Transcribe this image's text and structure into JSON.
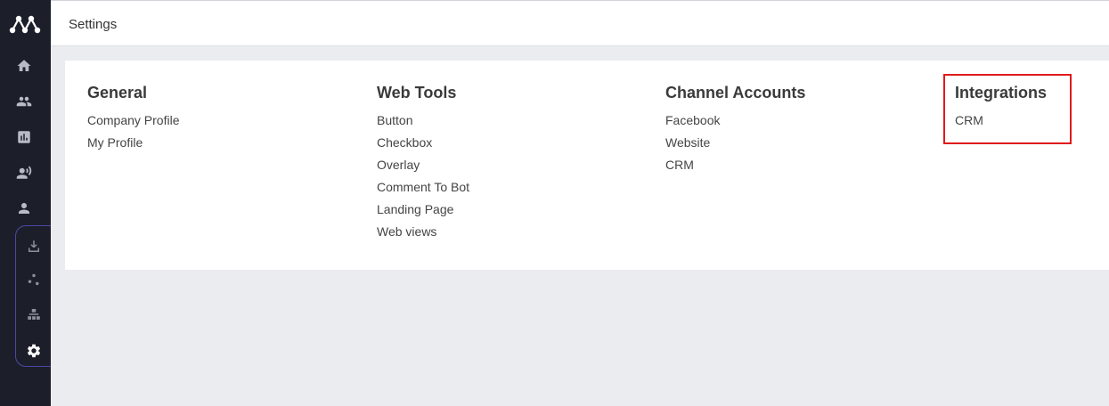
{
  "header": {
    "title": "Settings"
  },
  "sidebar": {
    "items": [
      {
        "icon": "home-icon"
      },
      {
        "icon": "people-icon"
      },
      {
        "icon": "bar-chart-icon"
      },
      {
        "icon": "broadcast-user-icon"
      },
      {
        "icon": "person-icon"
      },
      {
        "icon": "download-icon"
      },
      {
        "icon": "nodes-icon"
      },
      {
        "icon": "hierarchy-icon"
      },
      {
        "icon": "gear-icon"
      }
    ]
  },
  "settings": {
    "general": {
      "title": "General",
      "links": [
        "Company Profile",
        "My Profile"
      ]
    },
    "web_tools": {
      "title": "Web Tools",
      "links": [
        "Button",
        "Checkbox",
        "Overlay",
        "Comment To Bot",
        "Landing Page",
        "Web views"
      ]
    },
    "channel_accounts": {
      "title": "Channel Accounts",
      "links": [
        "Facebook",
        "Website",
        "CRM"
      ]
    },
    "integrations": {
      "title": "Integrations",
      "links": [
        "CRM"
      ]
    }
  },
  "colors": {
    "sidebar_bg": "#1c1e2a",
    "highlight": "#e01a1a",
    "page_bg": "#ebecef"
  }
}
